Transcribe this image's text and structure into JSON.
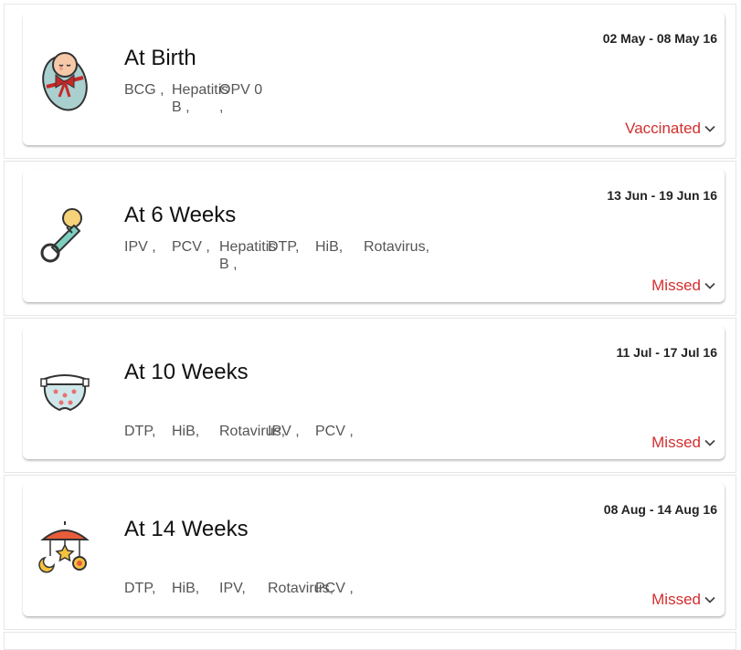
{
  "schedule": [
    {
      "title": "At Birth",
      "date_range": "02 May - 08 May 16",
      "status": "Vaccinated",
      "icon": "baby-bundle-icon",
      "vaccines": [
        "BCG ,",
        "Hepatitis B ,",
        "OPV 0 ,"
      ]
    },
    {
      "title": "At 6 Weeks",
      "date_range": "13 Jun - 19 Jun 16",
      "status": "Missed",
      "icon": "pacifier-icon",
      "vaccines": [
        "IPV ,",
        "PCV ,",
        "Hepatitis B ,",
        "DTP,",
        "HiB,",
        "Rotavirus,"
      ]
    },
    {
      "title": "At 10 Weeks",
      "date_range": "11 Jul - 17 Jul 16",
      "status": "Missed",
      "icon": "diaper-icon",
      "vaccines": [
        "DTP,",
        "HiB,",
        "Rotavirus,",
        "IPV ,",
        "PCV ,"
      ]
    },
    {
      "title": "At 14 Weeks",
      "date_range": "08 Aug - 14 Aug 16",
      "status": "Missed",
      "icon": "crib-mobile-icon",
      "vaccines": [
        "DTP,",
        "HiB,",
        "IPV,",
        "Rotavirus,",
        "PCV ,"
      ]
    }
  ],
  "colors": {
    "status_red": "#d32f2f",
    "text_grey": "#555555"
  }
}
